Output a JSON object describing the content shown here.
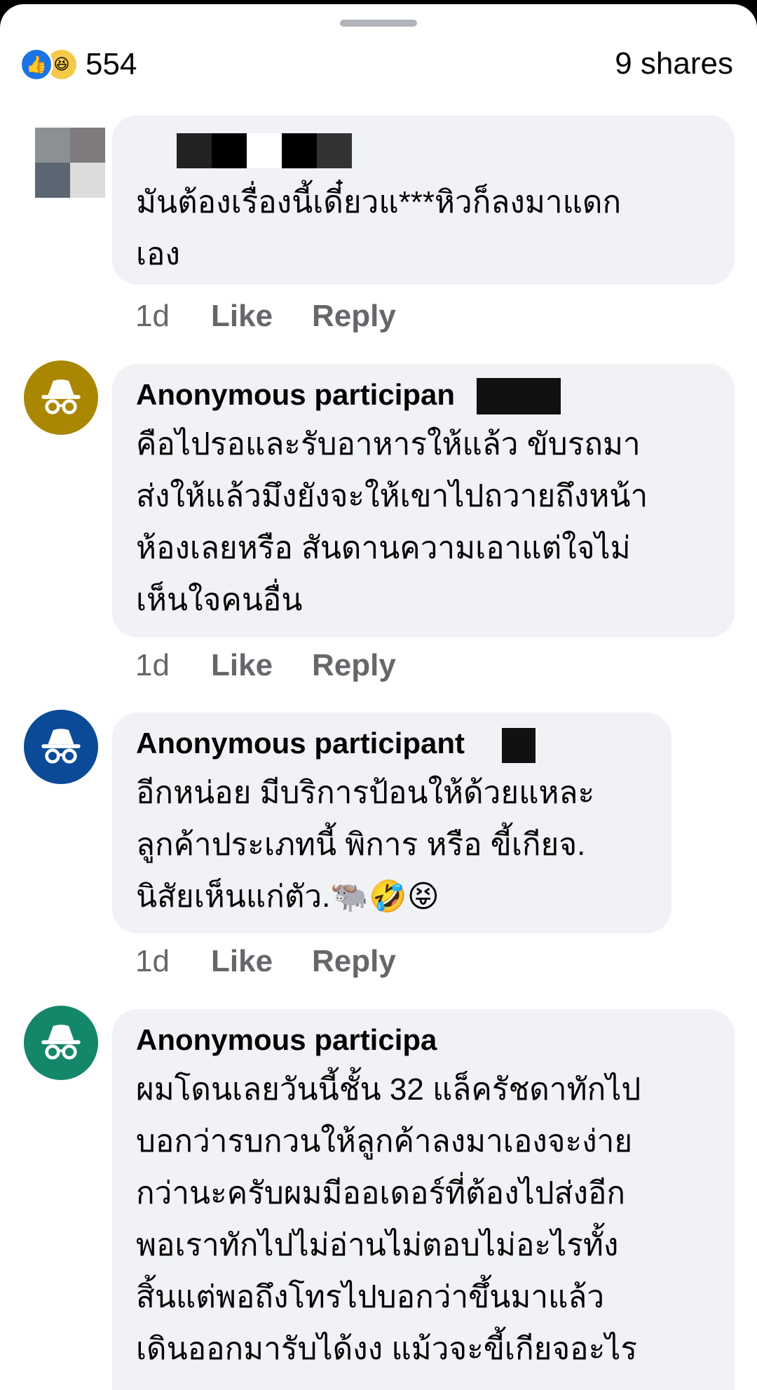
{
  "summary": {
    "reaction_count": "554",
    "shares": "9 shares",
    "reaction_icons": [
      "like-icon",
      "haha-icon"
    ]
  },
  "actions": {
    "like": "Like",
    "reply": "Reply"
  },
  "comments": [
    {
      "author": "",
      "time": "1d",
      "lines": [
        "มันต้องเรื่องนี้เดี๋ยวแ***หิวก็ลงมาแดก",
        "เอง"
      ]
    },
    {
      "author": "Anonymous participan",
      "time": "1d",
      "avatar_color": "#a98700",
      "lines": [
        "คือไปรอและรับอาหารให้แล้ว ขับรถมา",
        "ส่งให้แล้วมึงยังจะให้เขาไปถวายถึงหน้า",
        "ห้องเลยหรือ สันดานความเอาแต่ใจไม่",
        "เห็นใจคนอื่น"
      ]
    },
    {
      "author": "Anonymous participant",
      "time": "1d",
      "avatar_color": "#0b4a96",
      "lines": [
        "อีกหน่อย มีบริการป้อนให้ด้วยแหละ",
        "ลูกค้าประเภทนี้ พิการ หรือ ขี้เกียจ.",
        "นิสัยเห็นแก่ตัว.🐃🤣😝"
      ]
    },
    {
      "author": "Anonymous participa",
      "time": "",
      "avatar_color": "#14876a",
      "lines": [
        "ผมโดนเลยวันนี้ชั้น 32 แล็ครัชดาทักไป",
        "บอกว่ารบกวนให้ลูกค้าลงมาเองจะง่าย",
        "กว่านะครับผมมีออเดอร์ที่ต้องไปส่งอีก",
        "พอเราทักไปไม่อ่านไม่ตอบไม่อะไรทั้ง",
        "สิ้นแต่พอถึงโทรไปบอกว่าขึ้นมาแล้ว",
        "เดินออกมารับได้งง แม้วจะขี้เกียจอะไร"
      ]
    }
  ]
}
